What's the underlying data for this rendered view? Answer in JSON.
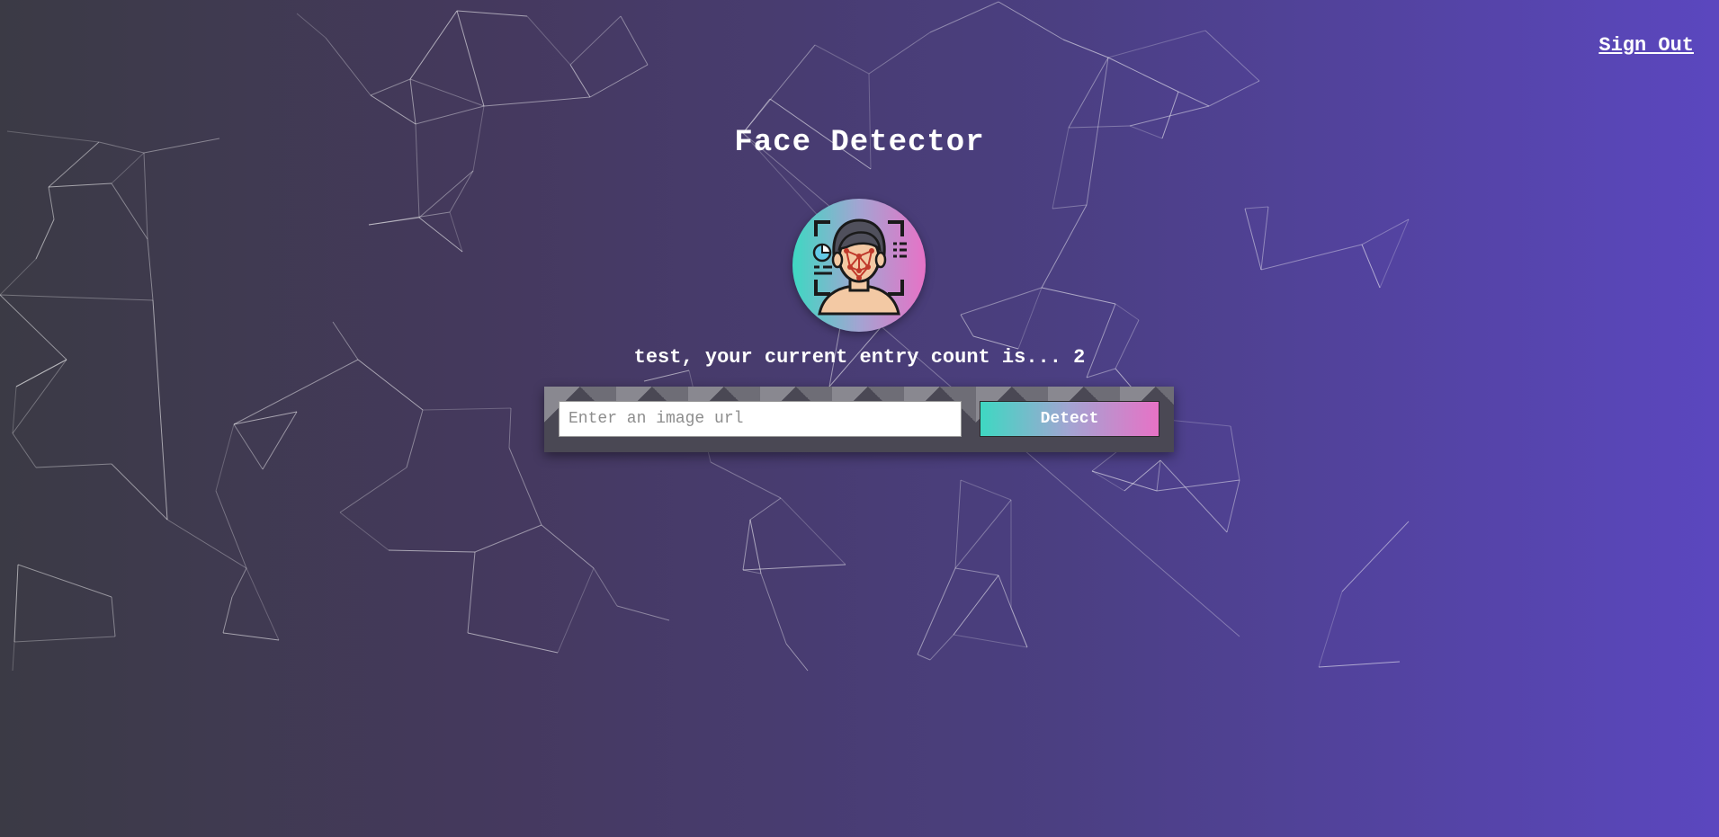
{
  "nav": {
    "sign_out_label": "Sign Out"
  },
  "header": {
    "title": "Face Detector"
  },
  "logo": {
    "icon": "face-recognition-icon"
  },
  "rank": {
    "text": "test, your current entry count is... 2"
  },
  "form": {
    "url_placeholder": "Enter an image url",
    "detect_label": "Detect"
  },
  "colors": {
    "background_start": "#3b3a45",
    "background_end": "#5b47bf",
    "accent_teal": "#3ed8c2",
    "accent_pink": "#e772c6",
    "form_box": "#4a4854"
  }
}
